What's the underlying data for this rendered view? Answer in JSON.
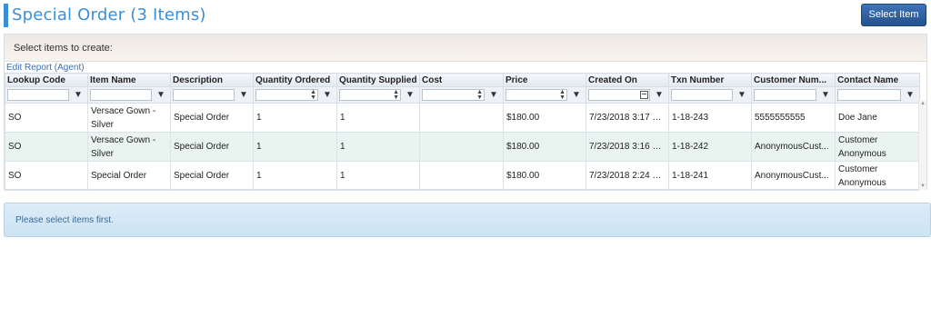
{
  "header": {
    "title": "Special Order (3 Items)",
    "select_button": "Select Item"
  },
  "panel": {
    "heading": "Select items to create:",
    "edit_report_link": "Edit Report (Agent)"
  },
  "grid": {
    "columns": [
      "Lookup Code",
      "Item Name",
      "Description",
      "Quantity Ordered",
      "Quantity Supplied",
      "Cost",
      "Price",
      "Created On",
      "Txn Number",
      "Customer Num...",
      "Contact Name"
    ],
    "rows": [
      [
        "SO",
        "Versace Gown - Silver",
        "Special Order",
        "1",
        "1",
        "",
        "$180.00",
        "7/23/2018 3:17 PM",
        "1-18-243",
        "5555555555",
        "Doe Jane"
      ],
      [
        "SO",
        "Versace Gown - Silver",
        "Special Order",
        "1",
        "1",
        "",
        "$180.00",
        "7/23/2018 3:16 PM",
        "1-18-242",
        "AnonymousCust...",
        "Customer Anonymous"
      ],
      [
        "SO",
        "Special Order",
        "Special Order",
        "1",
        "1",
        "",
        "$180.00",
        "7/23/2018 2:24 PM",
        "1-18-241",
        "AnonymousCust...",
        "Customer Anonymous"
      ]
    ]
  },
  "notice": {
    "text": "Please select items first."
  },
  "colors": {
    "title": "#3b8fd4",
    "button": "#2d5fa0",
    "alt_row": "#e9f4f1",
    "notice_bg": "#d4e8f5"
  },
  "icons": {
    "filter": "filter-icon",
    "calendar": "calendar-icon",
    "spinner": "spinner-icon"
  }
}
